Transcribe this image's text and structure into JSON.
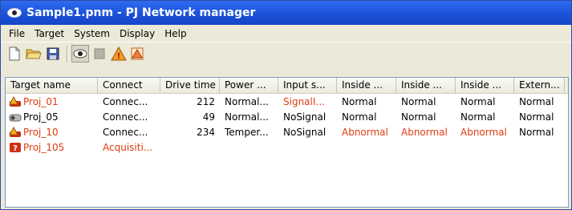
{
  "window": {
    "title": "Sample1.pnm - PJ Network manager"
  },
  "menu": [
    "File",
    "Target",
    "System",
    "Display",
    "Help"
  ],
  "toolbar": {
    "icons": [
      "new-file-icon",
      "open-folder-icon",
      "save-icon",
      "monitor-icon",
      "stop-icon",
      "warning-icon",
      "alert-settings-icon"
    ]
  },
  "columns": [
    "Target name",
    "Connect",
    "Drive time",
    "Power ...",
    "Input s...",
    "Inside ...",
    "Inside ...",
    "Inside ...",
    "Extern..."
  ],
  "rows": [
    {
      "name": "Proj_01",
      "connect": "Connec...",
      "drive_time": "212",
      "power": "Normal...",
      "input": "SignalI...",
      "inside1": "Normal",
      "inside2": "Normal",
      "inside3": "Normal",
      "external": "Normal",
      "status_icon": "warning-projector-icon"
    },
    {
      "name": "Proj_05",
      "connect": "Connec...",
      "drive_time": "49",
      "power": "Normal...",
      "input": "NoSignal",
      "inside1": "Normal",
      "inside2": "Normal",
      "inside3": "Normal",
      "external": "Normal",
      "status_icon": "projector-icon"
    },
    {
      "name": "Proj_10",
      "connect": "Connec...",
      "drive_time": "234",
      "power": "Temper...",
      "input": "NoSignal",
      "inside1": "Abnormal",
      "inside2": "Abnormal",
      "inside3": "Abnormal",
      "external": "Normal",
      "status_icon": "warning-projector-icon"
    },
    {
      "name": "Proj_105",
      "connect": "Acquisiti...",
      "drive_time": "",
      "power": "",
      "input": "",
      "inside1": "",
      "inside2": "",
      "inside3": "",
      "external": "",
      "status_icon": "error-projector-icon"
    }
  ],
  "colors": {
    "title_bar": "#1a4fd8",
    "alert_text": "#e03a12"
  }
}
